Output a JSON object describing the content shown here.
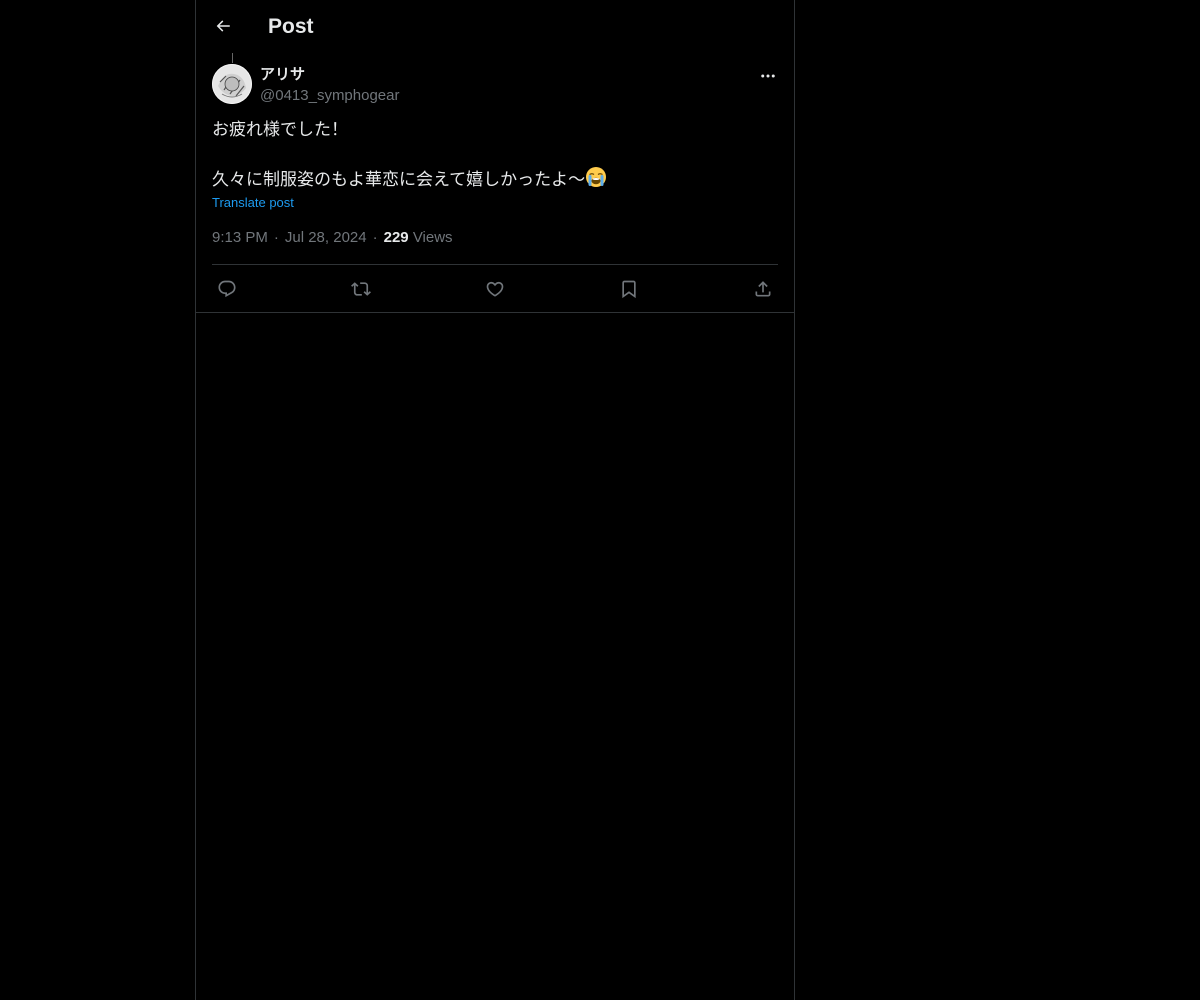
{
  "header": {
    "title": "Post",
    "back_icon": "arrow-left-icon"
  },
  "post": {
    "author": {
      "display_name": "アリサ",
      "handle": "@0413_symphogear"
    },
    "text_line1": "お疲れ様でした！",
    "text_line2": "久々に制服姿のもよ華恋に会えて嬉しかったよ〜",
    "emoji_name": "loudly-crying-face-icon",
    "translate_label": "Translate post",
    "time": "9:13 PM",
    "date": "Jul 28, 2024",
    "views_count": "229",
    "views_label": "Views"
  },
  "actions": {
    "reply": "reply-icon",
    "repost": "repost-icon",
    "like": "heart-icon",
    "bookmark": "bookmark-icon",
    "share": "share-icon"
  },
  "colors": {
    "background": "#000000",
    "text": "#e7e9ea",
    "secondary_text": "#71767b",
    "link": "#1d9bf0",
    "border": "#2f3336"
  }
}
